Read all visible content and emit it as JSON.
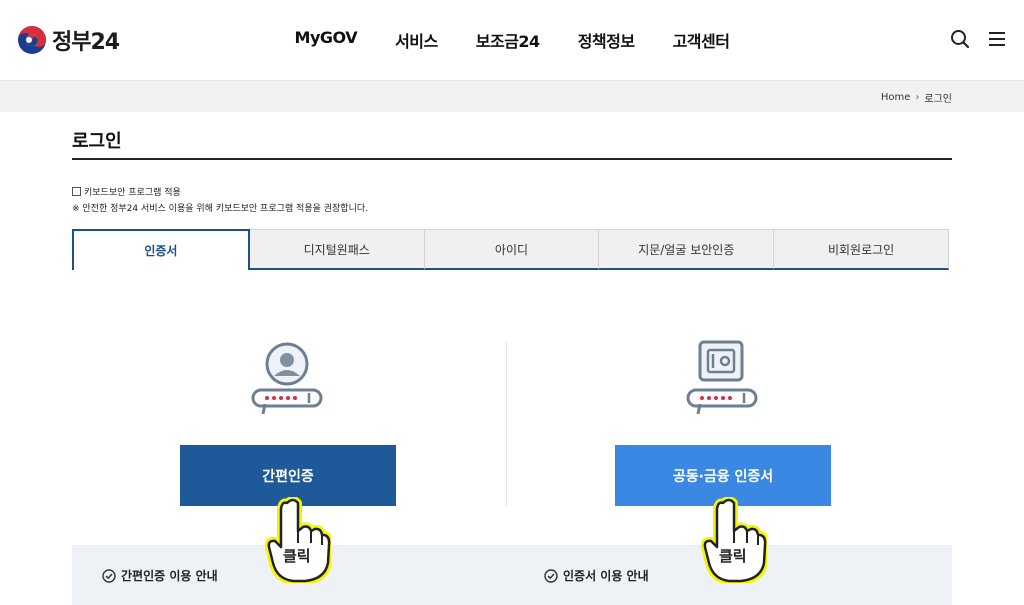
{
  "header": {
    "logo_text": "정부24",
    "nav": [
      "MyGOV",
      "서비스",
      "보조금24",
      "정책정보",
      "고객센터"
    ],
    "icons": [
      "search-icon",
      "menu-icon"
    ]
  },
  "breadcrumb": {
    "home": "Home",
    "current": "로그인"
  },
  "page": {
    "title": "로그인",
    "keyboard_option": "키보드보안 프로그램 적용",
    "keyboard_note": "※ 안전한 정부24 서비스 이용을 위해 키보드보안 프로그램 적용을 권장합니다."
  },
  "tabs": [
    "인증서",
    "디지털원패스",
    "아이디",
    "지문/얼굴 보안인증",
    "비회원로그인"
  ],
  "methods": {
    "simple": {
      "button": "간편인증",
      "guide": "간편인증 이용 안내"
    },
    "cert": {
      "button": "공동·금융 인증서",
      "guide": "인증서 이용 안내"
    }
  },
  "annotations": {
    "click_label": "클릭"
  },
  "colors": {
    "primary": "#1e5a9a",
    "secondary": "#3a88e3",
    "accent_tab": "#1d4f8b"
  }
}
